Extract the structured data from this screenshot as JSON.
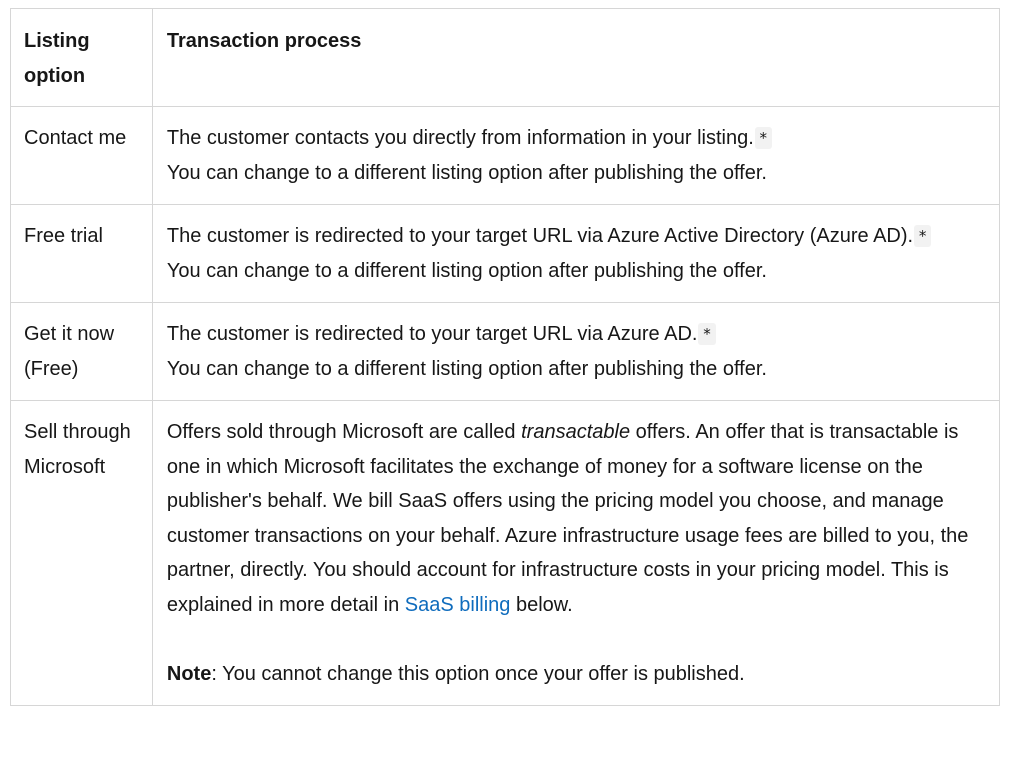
{
  "table": {
    "headers": [
      "Listing option",
      "Transaction process"
    ],
    "rows": [
      {
        "option": "Contact me",
        "line1": "The customer contacts you directly from information in your listing.",
        "marker": "*",
        "line2": "You can change to a different listing option after publishing the offer."
      },
      {
        "option": "Free trial",
        "line1": "The customer is redirected to your target URL via Azure Active Directory (Azure AD).",
        "marker": "*",
        "line2": "You can change to a different listing option after publishing the offer."
      },
      {
        "option": "Get it now (Free)",
        "line1": "The customer is redirected to your target URL via Azure AD.",
        "marker": "*",
        "line2": "You can change to a different listing option after publishing the offer."
      },
      {
        "option": "Sell through Microsoft",
        "text_before_em": "Offers sold through Microsoft are called ",
        "em_text": "transactable",
        "text_after_em": " offers. An offer that is transactable is one in which Microsoft facilitates the exchange of money for a software license on the publisher's behalf. We bill SaaS offers using the pricing model you choose, and manage customer transactions on your behalf. Azure infrastructure usage fees are billed to you, the partner, directly. You should account for infrastructure costs in your pricing model. This is explained in more detail in ",
        "link_text": "SaaS billing",
        "text_after_link": " below.",
        "note_label": "Note",
        "note_text": ": You cannot change this option once your offer is published."
      }
    ]
  },
  "colors": {
    "link": "#0f6cbd",
    "border": "#d6d6d6",
    "code_bg": "#f2f2f2"
  }
}
